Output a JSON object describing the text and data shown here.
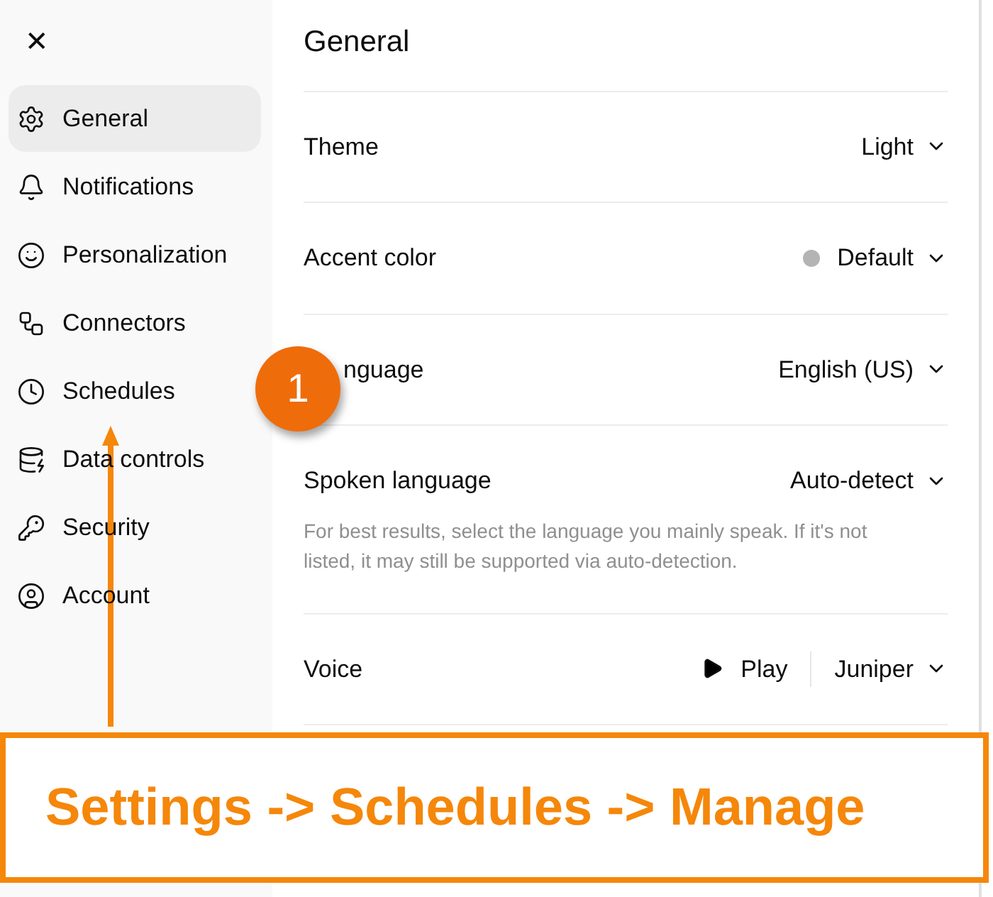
{
  "sidebar": {
    "close_label": "✕",
    "items": [
      {
        "label": "General",
        "selected": true
      },
      {
        "label": "Notifications",
        "selected": false
      },
      {
        "label": "Personalization",
        "selected": false
      },
      {
        "label": "Connectors",
        "selected": false
      },
      {
        "label": "Schedules",
        "selected": false
      },
      {
        "label": "Data controls",
        "selected": false
      },
      {
        "label": "Security",
        "selected": false
      },
      {
        "label": "Account",
        "selected": false
      }
    ]
  },
  "main": {
    "title": "General",
    "settings": [
      {
        "kind": "dropdown",
        "label": "Theme",
        "value": "Light"
      },
      {
        "kind": "color",
        "label": "Accent color",
        "value": "Default",
        "color": "#b4b4b4"
      },
      {
        "kind": "dropdown",
        "label": "nguage",
        "value": "English (US)"
      },
      {
        "kind": "dropdown",
        "label": "Spoken language",
        "value": "Auto-detect",
        "help": "For best results, select the language you mainly speak. If it's not listed, it may still be supported via auto-detection."
      },
      {
        "kind": "voice",
        "label": "Voice",
        "play": "Play",
        "value": "Juniper"
      }
    ]
  },
  "annotation": {
    "badge": "1",
    "caption": "Settings -> Schedules -> Manage"
  }
}
